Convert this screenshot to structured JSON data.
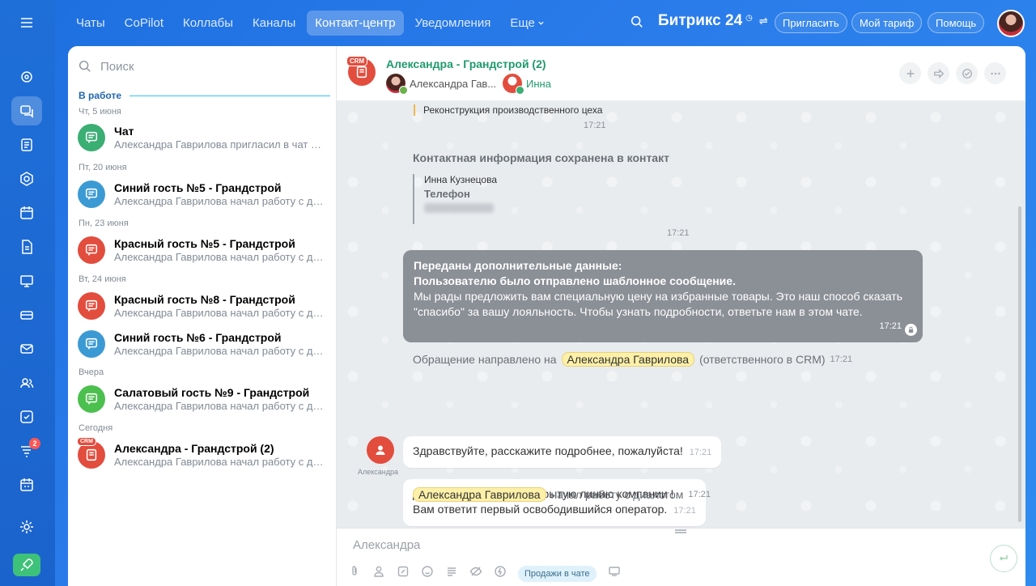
{
  "nav": {
    "tabs": [
      "Чаты",
      "CoPilot",
      "Коллабы",
      "Каналы",
      "Контакт-центр",
      "Уведомления",
      "Еще"
    ],
    "active": "Контакт-центр",
    "brand": "Битрикс 24",
    "buttons": {
      "invite": "Пригласить",
      "tariff": "Мой тариф",
      "help": "Помощь"
    }
  },
  "rail": {
    "badge_count": "2"
  },
  "list": {
    "search_placeholder": "Поиск",
    "section": "В работе",
    "dates": [
      "Чт, 5 июня",
      "Пт, 20 июня",
      "Пн, 23 июня",
      "Вт, 24 июня",
      "Вчера",
      "Сегодня"
    ],
    "chats": [
      {
        "name": "Чат",
        "msg": "Александра Гаврилова пригласил в чат Ел...",
        "color": "#3bae74"
      },
      {
        "name": "Синий гость №5 - Грандстрой",
        "msg": "Александра Гаврилова начал работу с ди...",
        "color": "#3b9ad4"
      },
      {
        "name": "Красный гость №5 - Грандстрой",
        "msg": "Александра Гаврилова начал работу с ди...",
        "color": "#e24d3e"
      },
      {
        "name": "Красный гость №8 - Грандстрой",
        "msg": "Александра Гаврилова начал работу с ди...",
        "color": "#e24d3e"
      },
      {
        "name": "Синий гость №6 - Грандстрой",
        "msg": "Александра Гаврилова начал работу с ди...",
        "color": "#3b9ad4"
      },
      {
        "name": "Салатовый гость №9 - Грандстрой",
        "msg": "Александра Гаврилова начал работу с ди...",
        "color": "#4cc04f"
      },
      {
        "name": "Александра - Грандстрой (2)",
        "msg": "Александра Гаврилова начал работу с ди...",
        "color": "#e24d3e"
      }
    ],
    "crm_tag": "CRM"
  },
  "dialog": {
    "title": "Александра - Грандстрой (2)",
    "participants": [
      "Александра Гав...",
      "Инна"
    ],
    "crm_tag": "CRM",
    "messages": {
      "quote_text": "Реконструкция производственного цеха",
      "time1": "17:21",
      "contact_title": "Контактная информация сохранена в контакт",
      "contact_name": "Инна Кузнецова",
      "contact_phone_label": "Телефон",
      "time2": "17:21",
      "sys_title1": "Переданы дополнительные данные:",
      "sys_title2": "Пользователю было отправлено шаблонное сообщение.",
      "sys_text": "Мы рады предложить вам специальную цену на избранные товары. Это наш способ сказать \"спасибо\" за вашу лояльность. Чтобы узнать подробности, ответьте нам в этом чате.",
      "sys_time": "17:21",
      "routed_prefix": "Обращение направлено на",
      "routed_user": "Александра Гаврилова",
      "routed_suffix": "(ответственного в CRM)",
      "routed_time": "17:21",
      "client_name": "Александра",
      "client_msg": "Здравствуйте, расскажите подробнее, пожалуйста!",
      "client_time": "17:21",
      "welcome_line1": "Добро пожаловать в Открытую линию компании !",
      "welcome_line2": "Вам ответит первый освободившийся оператор.",
      "welcome_time": "17:21",
      "start_user": "Александра Гаврилова",
      "start_text": "начал работу с диалогом",
      "start_time": "17:21"
    },
    "composer_placeholder": "Александра",
    "sales_label": "Продажи в чате"
  }
}
